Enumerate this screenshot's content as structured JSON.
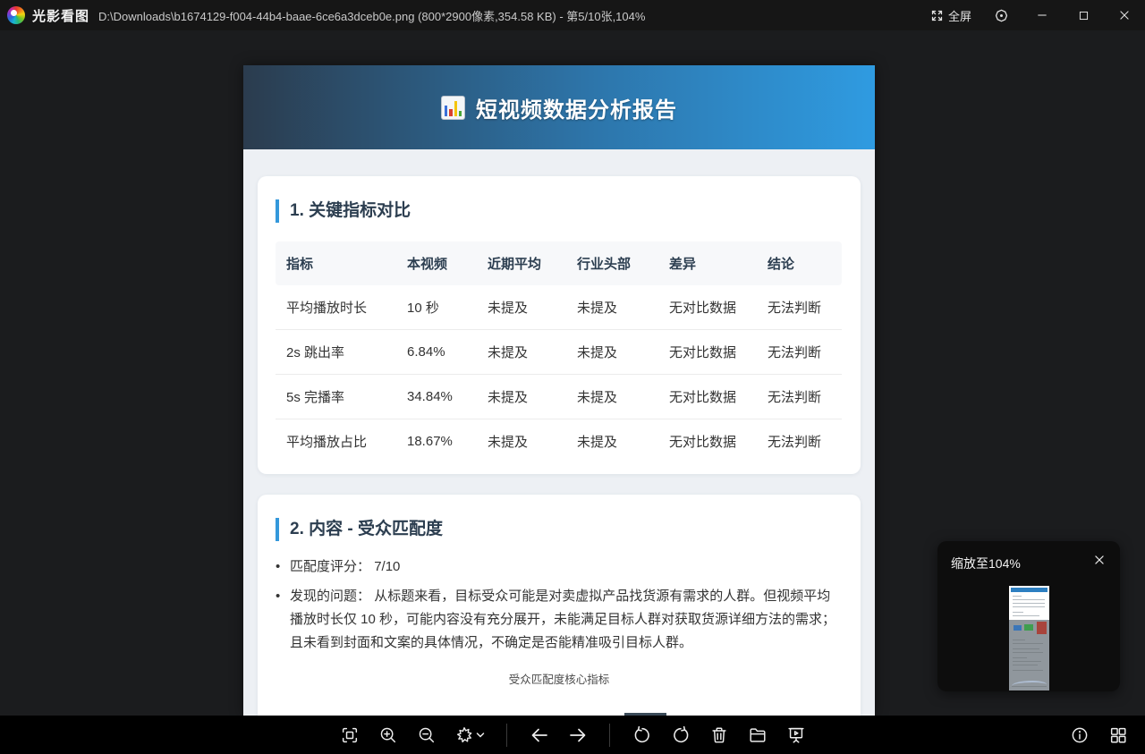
{
  "titlebar": {
    "app_name": "光影看图",
    "file_info": "D:\\Downloads\\b1674129-f004-44b4-baae-6ce6a3dceb0e.png (800*2900像素,354.58 KB) - 第5/10张,104%",
    "fullscreen_label": "全屏",
    "icons": [
      "fullscreen-icon",
      "settings-icon",
      "minimize-icon",
      "maximize-icon",
      "close-icon"
    ]
  },
  "viewer_image": {
    "title": "短视频数据分析报告",
    "title_icon": "bar-chart-emoji",
    "section1": {
      "heading": "1. 关键指标对比",
      "table": {
        "headers": [
          "指标",
          "本视频",
          "近期平均",
          "行业头部",
          "差异",
          "结论"
        ],
        "rows": [
          [
            "平均播放时长",
            "10 秒",
            "未提及",
            "未提及",
            "无对比数据",
            "无法判断"
          ],
          [
            "2s 跳出率",
            "6.84%",
            "未提及",
            "未提及",
            "无对比数据",
            "无法判断"
          ],
          [
            "5s 完播率",
            "34.84%",
            "未提及",
            "未提及",
            "无对比数据",
            "无法判断"
          ],
          [
            "平均播放占比",
            "18.67%",
            "未提及",
            "未提及",
            "无对比数据",
            "无法判断"
          ]
        ]
      }
    },
    "section2": {
      "heading": "2. 内容 - 受众匹配度",
      "score_label": "匹配度评分：",
      "score_value": "7/10",
      "problem_label": "发现的问题：",
      "problem_text": "从标题来看，目标受众可能是对卖虚拟产品找货源有需求的人群。但视频平均播放时长仅 10 秒，可能内容没有充分展开，未能满足目标人群对获取货源详细方法的需求；且未看到封面和文案的具体情况，不确定是否能精准吸引目标人群。",
      "chart_caption": "受众匹配度核心指标"
    }
  },
  "toolbar": {
    "icons": [
      "fit-to-screen-icon",
      "zoom-in-icon",
      "zoom-out-icon",
      "beautify-icon",
      "chevron-down-icon",
      "prev-image-icon",
      "next-image-icon",
      "rotate-left-icon",
      "rotate-right-icon",
      "delete-icon",
      "open-folder-icon",
      "slideshow-icon",
      "info-icon",
      "thumbnail-grid-icon"
    ]
  },
  "toast": {
    "message": "缩放至104%",
    "close_icon": "close-icon"
  },
  "colors": {
    "accent_blue": "#3498db",
    "header_gradient_start": "#2b3c4e",
    "header_gradient_end": "#2f9be1",
    "titlebar_bg": "#161616",
    "toolbar_bg": "#000000"
  }
}
